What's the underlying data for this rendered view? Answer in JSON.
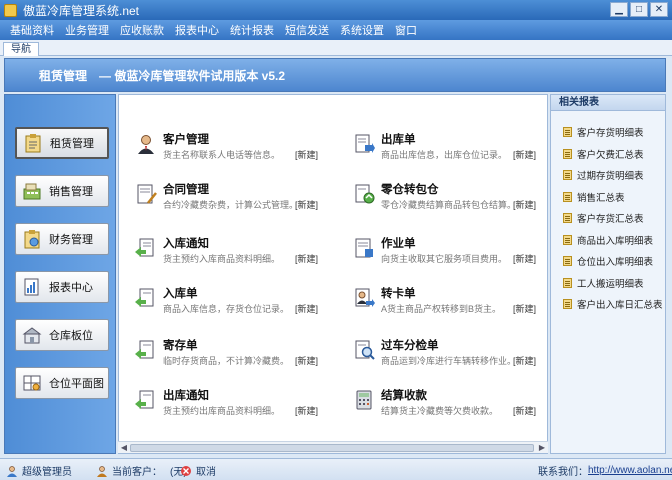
{
  "window": {
    "title": "傲蓝冷库管理系统.net"
  },
  "menu": [
    "基础资料",
    "业务管理",
    "应收账款",
    "报表中心",
    "统计报表",
    "短信发送",
    "系统设置",
    "窗口"
  ],
  "tab": "导航",
  "banner": "租赁管理　— 傲蓝冷库管理软件试用版本 v5.2",
  "nav": [
    {
      "label": "租赁管理",
      "icon": "clipboard-icon",
      "active": true
    },
    {
      "label": "销售管理",
      "icon": "cash-register-icon"
    },
    {
      "label": "财务管理",
      "icon": "finance-clipboard-icon"
    },
    {
      "label": "报表中心",
      "icon": "report-chart-icon"
    },
    {
      "label": "仓库板位",
      "icon": "warehouse-icon"
    },
    {
      "label": "仓位平面图",
      "icon": "floorplan-icon"
    }
  ],
  "items": [
    {
      "title": "客户管理",
      "desc": "货主名称联系人电话等信息。",
      "new": "[新建]",
      "icon": "customer-icon"
    },
    {
      "title": "出库单",
      "desc": "商品出库信息，出库仓位记录。",
      "new": "[新建]",
      "icon": "outbound-doc-icon"
    },
    {
      "title": "合同管理",
      "desc": "合约冷藏费杂费，计算公式管理。",
      "new": "[新建]",
      "icon": "contract-icon"
    },
    {
      "title": "零仓转包仓",
      "desc": "零仓冷藏费结算商品转包仓结算。",
      "new": "[新建]",
      "icon": "transfer-doc-icon"
    },
    {
      "title": "入库通知",
      "desc": "货主预约入库商品资料明细。",
      "new": "[新建]",
      "icon": "inbound-notice-icon"
    },
    {
      "title": "作业单",
      "desc": "向货主收取其它服务项目费用。",
      "new": "[新建]",
      "icon": "work-order-icon"
    },
    {
      "title": "入库单",
      "desc": "商品入库信息，存货仓位记录。",
      "new": "[新建]",
      "icon": "inbound-doc-icon"
    },
    {
      "title": "转卡单",
      "desc": "A货主商品产权转移到B货主。",
      "new": "[新建]",
      "icon": "transfer-card-icon"
    },
    {
      "title": "寄存单",
      "desc": "临时存货商品，不计算冷藏费。",
      "new": "[新建]",
      "icon": "deposit-doc-icon"
    },
    {
      "title": "过车分检单",
      "desc": "商品运到冷库进行车辆转移作业。",
      "new": "[新建]",
      "icon": "inspection-icon"
    },
    {
      "title": "出库通知",
      "desc": "货主预约出库商品资料明细。",
      "new": "[新建]",
      "icon": "outbound-notice-icon"
    },
    {
      "title": "结算收款",
      "desc": "结算货主冷藏费等欠费收款。",
      "new": "[新建]",
      "icon": "calculator-icon"
    }
  ],
  "related": {
    "title": "相关报表",
    "items": [
      "客户存货明细表",
      "客户欠费汇总表",
      "过期存货明细表",
      "销售汇总表",
      "客户存货汇总表",
      "商品出入库明细表",
      "仓位出入库明细表",
      "工人搬运明细表",
      "客户出入库日汇总表"
    ]
  },
  "status": {
    "user": "超级管理员",
    "customer_label": "当前客户：",
    "customer_value": "(无)",
    "cancel": "取消",
    "contact_label": "联系我们：",
    "contact_url": "http://www.aolan.net"
  },
  "colors": {
    "accent": "#3574c4",
    "panel": "#5e9be0"
  }
}
